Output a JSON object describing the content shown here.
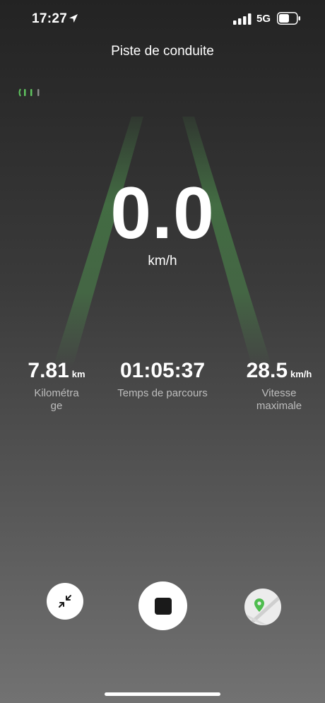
{
  "status_bar": {
    "time": "17:27",
    "network": "5G",
    "icons": {
      "location": "location-arrow-icon",
      "signal": "signal-bars-icon",
      "battery": "battery-icon"
    }
  },
  "header": {
    "title": "Piste de conduite"
  },
  "connection": {
    "icon": "connection-signal-icon",
    "color": "#5fc35f"
  },
  "speed": {
    "value": "0.0",
    "unit": "km/h"
  },
  "stats": {
    "distance": {
      "value": "7.81",
      "unit": "km",
      "label_line1": "Kilométra",
      "label_line2": "ge"
    },
    "ride_time": {
      "value": "01:05:37",
      "label": "Temps de parcours"
    },
    "max_speed": {
      "value": "28.5",
      "unit": "km/h",
      "label_line1": "Vitesse",
      "label_line2": "maximale"
    }
  },
  "controls": {
    "collapse": {
      "icon": "collapse-arrows-icon"
    },
    "stop": {
      "icon": "stop-icon"
    },
    "map": {
      "icon": "map-pin-icon"
    }
  },
  "colors": {
    "accent": "#5fc35f",
    "background_top": "#232323",
    "background_bottom": "#727272"
  }
}
